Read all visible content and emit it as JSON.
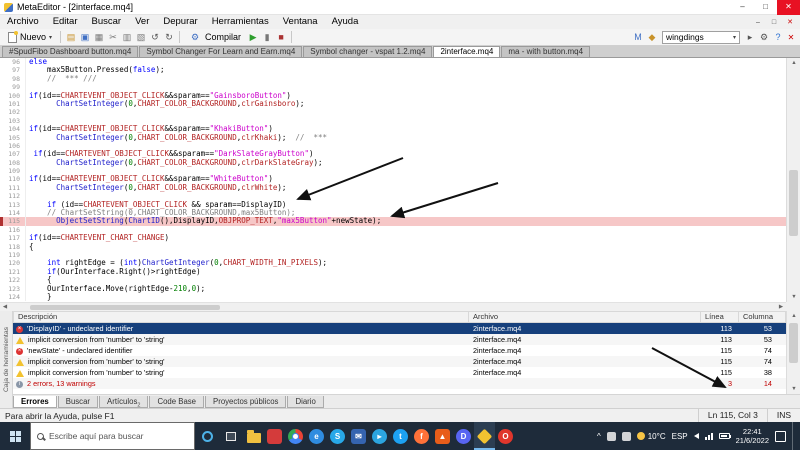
{
  "window": {
    "title": "MetaEditor - [2interface.mq4]"
  },
  "glyphs": {
    "min": "–",
    "max": "□",
    "close": "✕",
    "caret_down": "▾",
    "up": "▲",
    "down": "▼",
    "left": "◀",
    "right": "▶",
    "chevron_up": "^",
    "x": "×",
    "info": "i",
    "gear": "⚙"
  },
  "colors": {
    "highlight_line_bg": "#f6c7c7",
    "selection_bg": "#16407c",
    "error_red": "#c00000",
    "taskbar_bg": "#1e2b3a"
  },
  "menu": {
    "items": [
      "Archivo",
      "Editar",
      "Buscar",
      "Ver",
      "Depurar",
      "Herramientas",
      "Ventana",
      "Ayuda"
    ]
  },
  "toolbar": {
    "new_label": "Nuevo",
    "compile_label": "Compilar",
    "search_value": "wingdings",
    "groups": {
      "g1": [
        {
          "name": "open-file-icon",
          "glyph": "▤",
          "color": "#c8922a"
        },
        {
          "name": "save-icon",
          "glyph": "▣",
          "color": "#3f6fc4"
        },
        {
          "name": "print-icon",
          "glyph": "▦",
          "color": "#777777"
        },
        {
          "name": "cut-icon",
          "glyph": "✂",
          "color": "#777777"
        },
        {
          "name": "copy-icon",
          "glyph": "▥",
          "color": "#777777"
        },
        {
          "name": "paste-icon",
          "glyph": "▧",
          "color": "#777777"
        },
        {
          "name": "undo-icon",
          "glyph": "↺",
          "color": "#555555"
        },
        {
          "name": "redo-icon",
          "glyph": "↻",
          "color": "#555555"
        }
      ],
      "g2": [
        {
          "name": "start-debug-icon",
          "glyph": "▶",
          "color": "#2d9e2d"
        },
        {
          "name": "pause-icon",
          "glyph": "▮",
          "color": "#777777"
        },
        {
          "name": "stop-icon",
          "glyph": "■",
          "color": "#aa3333"
        }
      ],
      "g3": [
        {
          "name": "mql5-community-icon",
          "glyph": "M",
          "color": "#3f6fc4"
        },
        {
          "name": "terminal-icon",
          "glyph": "◆",
          "color": "#c8922a"
        }
      ],
      "g4": [
        {
          "name": "search-next-icon",
          "glyph": "▸",
          "color": "#555555"
        },
        {
          "name": "settings-icon",
          "glyph": "⚙",
          "color": "#555555"
        },
        {
          "name": "help-icon",
          "glyph": "?",
          "color": "#2a6fd0"
        }
      ]
    }
  },
  "file_tabs": [
    {
      "label": "#SpudFibo Dashboard button.mq4",
      "active": false
    },
    {
      "label": "Symbol Changer For Learn and Earn.mq4",
      "active": false
    },
    {
      "label": "Symbol changer - vspat 1.2.mq4",
      "active": false
    },
    {
      "label": "2interface.mq4",
      "active": true
    },
    {
      "label": "ma - with button.mq4",
      "active": false
    }
  ],
  "editor": {
    "highlight_line": 115,
    "lines": [
      {
        "n": 96,
        "seg": [
          [
            "k",
            "else"
          ]
        ]
      },
      {
        "n": 97,
        "seg": [
          [
            "p",
            "    max5Button.Pressed("
          ],
          [
            "k",
            "false"
          ],
          [
            "p",
            ");"
          ]
        ]
      },
      {
        "n": 98,
        "seg": [
          [
            "m",
            "    //  *** ///"
          ]
        ]
      },
      {
        "n": 99,
        "seg": []
      },
      {
        "n": 100,
        "seg": [
          [
            "k",
            "if"
          ],
          [
            "p",
            "(id=="
          ],
          [
            "c",
            "CHARTEVENT_OBJECT_CLICK"
          ],
          [
            "p",
            "&&sparam=="
          ],
          [
            "s",
            "\"GainsboroButton\""
          ],
          [
            "p",
            ")"
          ]
        ]
      },
      {
        "n": 101,
        "seg": [
          [
            "p",
            "      "
          ],
          [
            "f",
            "ChartSetInteger"
          ],
          [
            "p",
            "("
          ],
          [
            "n",
            "0"
          ],
          [
            "p",
            ","
          ],
          [
            "c",
            "CHART_COLOR_BACKGROUND"
          ],
          [
            "p",
            ","
          ],
          [
            "c",
            "clrGainsboro"
          ],
          [
            "p",
            ");"
          ]
        ]
      },
      {
        "n": 102,
        "seg": []
      },
      {
        "n": 103,
        "seg": []
      },
      {
        "n": 104,
        "seg": [
          [
            "k",
            "if"
          ],
          [
            "p",
            "(id=="
          ],
          [
            "c",
            "CHARTEVENT_OBJECT_CLICK"
          ],
          [
            "p",
            "&&sparam=="
          ],
          [
            "s",
            "\"KhakiButton\""
          ],
          [
            "p",
            ")"
          ]
        ]
      },
      {
        "n": 105,
        "seg": [
          [
            "p",
            "      "
          ],
          [
            "f",
            "ChartSetInteger"
          ],
          [
            "p",
            "("
          ],
          [
            "n",
            "0"
          ],
          [
            "p",
            ","
          ],
          [
            "c",
            "CHART_COLOR_BACKGROUND"
          ],
          [
            "p",
            ","
          ],
          [
            "c",
            "clrKhaki"
          ],
          [
            "p",
            ");  "
          ],
          [
            "m",
            "//  ***"
          ]
        ]
      },
      {
        "n": 106,
        "seg": []
      },
      {
        "n": 107,
        "seg": [
          [
            "p",
            " "
          ],
          [
            "k",
            "if"
          ],
          [
            "p",
            "(id=="
          ],
          [
            "c",
            "CHARTEVENT_OBJECT_CLICK"
          ],
          [
            "p",
            "&&sparam=="
          ],
          [
            "s",
            "\"DarkSlateGrayButton\""
          ],
          [
            "p",
            ")"
          ]
        ]
      },
      {
        "n": 108,
        "seg": [
          [
            "p",
            "      "
          ],
          [
            "f",
            "ChartSetInteger"
          ],
          [
            "p",
            "("
          ],
          [
            "n",
            "0"
          ],
          [
            "p",
            ","
          ],
          [
            "c",
            "CHART_COLOR_BACKGROUND"
          ],
          [
            "p",
            ","
          ],
          [
            "c",
            "clrDarkSlateGray"
          ],
          [
            "p",
            ");"
          ]
        ]
      },
      {
        "n": 109,
        "seg": []
      },
      {
        "n": 110,
        "seg": [
          [
            "k",
            "if"
          ],
          [
            "p",
            "(id=="
          ],
          [
            "c",
            "CHARTEVENT_OBJECT_CLICK"
          ],
          [
            "p",
            "&&sparam=="
          ],
          [
            "s",
            "\"WhiteButton\""
          ],
          [
            "p",
            ")"
          ]
        ]
      },
      {
        "n": 111,
        "seg": [
          [
            "p",
            "      "
          ],
          [
            "f",
            "ChartSetInteger"
          ],
          [
            "p",
            "("
          ],
          [
            "n",
            "0"
          ],
          [
            "p",
            ","
          ],
          [
            "c",
            "CHART_COLOR_BACKGROUND"
          ],
          [
            "p",
            ","
          ],
          [
            "c",
            "clrWhite"
          ],
          [
            "p",
            ");"
          ]
        ]
      },
      {
        "n": 112,
        "seg": []
      },
      {
        "n": 113,
        "seg": [
          [
            "p",
            "    "
          ],
          [
            "k",
            "if"
          ],
          [
            "p",
            " (id=="
          ],
          [
            "c",
            "CHARTEVENT_OBJECT_CLICK"
          ],
          [
            "p",
            " && sparam==DisplayID)"
          ]
        ]
      },
      {
        "n": 114,
        "seg": [
          [
            "m",
            "    // ChartSetString(0,CHART_COLOR_BACKGROUND,max5Button);"
          ]
        ]
      },
      {
        "n": 115,
        "seg": [
          [
            "p",
            "      "
          ],
          [
            "f",
            "ObjectSetString"
          ],
          [
            "p",
            "("
          ],
          [
            "f",
            "ChartID"
          ],
          [
            "p",
            "(),DisplayID,"
          ],
          [
            "c",
            "OBJPROP_TEXT"
          ],
          [
            "p",
            ","
          ],
          [
            "s",
            "\"max5Button\""
          ],
          [
            "p",
            "+newState);"
          ]
        ]
      },
      {
        "n": 116,
        "seg": []
      },
      {
        "n": 117,
        "seg": [
          [
            "k",
            "if"
          ],
          [
            "p",
            "(id=="
          ],
          [
            "c",
            "CHARTEVENT_CHART_CHANGE"
          ],
          [
            "p",
            ")"
          ]
        ]
      },
      {
        "n": 118,
        "seg": [
          [
            "p",
            "{"
          ]
        ]
      },
      {
        "n": 119,
        "seg": []
      },
      {
        "n": 120,
        "seg": [
          [
            "p",
            "    "
          ],
          [
            "k",
            "int"
          ],
          [
            "p",
            " rightEdge = ("
          ],
          [
            "k",
            "int"
          ],
          [
            "p",
            ")"
          ],
          [
            "f",
            "ChartGetInteger"
          ],
          [
            "p",
            "("
          ],
          [
            "n",
            "0"
          ],
          [
            "p",
            ","
          ],
          [
            "c",
            "CHART_WIDTH_IN_PIXELS"
          ],
          [
            "p",
            ");"
          ]
        ]
      },
      {
        "n": 121,
        "seg": [
          [
            "p",
            "    "
          ],
          [
            "k",
            "if"
          ],
          [
            "p",
            "(OurInterface.Right()>rightEdge)"
          ]
        ]
      },
      {
        "n": 122,
        "seg": [
          [
            "p",
            "    {"
          ]
        ]
      },
      {
        "n": 123,
        "seg": [
          [
            "p",
            "    OurInterface.Move(rightEdge-"
          ],
          [
            "n",
            "210"
          ],
          [
            "p",
            ","
          ],
          [
            "n",
            "0"
          ],
          [
            "p",
            ");"
          ]
        ]
      },
      {
        "n": 124,
        "seg": [
          [
            "p",
            "    }"
          ]
        ]
      }
    ]
  },
  "errors_panel": {
    "columns": [
      "Descripción",
      "Archivo",
      "Línea",
      "Columna"
    ],
    "rows": [
      {
        "icon": "error",
        "desc": "'DisplayID' - undeclared identifier",
        "file": "2interface.mq4",
        "line": "113",
        "col": "53",
        "selected": true
      },
      {
        "icon": "warning",
        "desc": "implicit conversion from 'number' to 'string'",
        "file": "2interface.mq4",
        "line": "113",
        "col": "53"
      },
      {
        "icon": "error",
        "desc": "'newState' - undeclared identifier",
        "file": "2interface.mq4",
        "line": "115",
        "col": "74"
      },
      {
        "icon": "warning",
        "desc": "implicit conversion from 'number' to 'string'",
        "file": "2interface.mq4",
        "line": "115",
        "col": "74"
      },
      {
        "icon": "warning",
        "desc": "implicit conversion from 'number' to 'string'",
        "file": "2interface.mq4",
        "line": "115",
        "col": "38"
      },
      {
        "icon": "summary",
        "desc": "2 errors, 13 warnings",
        "file": "",
        "line": "3",
        "col": "14",
        "summary": true
      }
    ]
  },
  "toolbox_label": "Caja de herramientas",
  "bottom_tabs": [
    {
      "label": "Errores",
      "active": true
    },
    {
      "label": "Buscar",
      "active": false
    },
    {
      "label": "Artículos",
      "badge": "2",
      "active": false
    },
    {
      "label": "Code Base",
      "active": false
    },
    {
      "label": "Proyectos públicos",
      "active": false
    },
    {
      "label": "Diario",
      "active": false
    }
  ],
  "status_bar": {
    "help": "Para abrir la Ayuda, pulse F1",
    "position": "Ln 115, Col 3",
    "mode": "INS"
  },
  "taskbar": {
    "search_placeholder": "Escribe aquí para buscar",
    "icons": [
      {
        "name": "taskbar-file-explorer-icon",
        "color": "#f0c040",
        "shape": "folder",
        "letter": ""
      },
      {
        "name": "taskbar-app-red-icon",
        "color": "#d43b3b",
        "shape": "square",
        "letter": ""
      },
      {
        "name": "taskbar-chrome-icon",
        "color": "",
        "shape": "chrome",
        "letter": ""
      },
      {
        "name": "taskbar-edge-icon",
        "color": "#2f8ce0",
        "shape": "circle",
        "letter": "e"
      },
      {
        "name": "taskbar-skype-icon",
        "color": "#28a8e8",
        "shape": "circle",
        "letter": "S"
      },
      {
        "name": "taskbar-mail-icon",
        "color": "#3564b0",
        "shape": "square",
        "letter": "✉"
      },
      {
        "name": "taskbar-telegram-icon",
        "color": "#2ca5e0",
        "shape": "circle",
        "letter": "▸"
      },
      {
        "name": "taskbar-twitter-icon",
        "color": "#1da1f2",
        "shape": "circle",
        "letter": "t"
      },
      {
        "name": "taskbar-firefox-icon",
        "color": "#ff7139",
        "shape": "circle",
        "letter": "f"
      },
      {
        "name": "taskbar-vlc-icon",
        "color": "#e85d1a",
        "shape": "square",
        "letter": "▲"
      },
      {
        "name": "taskbar-discord-icon",
        "color": "#5865f2",
        "shape": "circle",
        "letter": "D"
      },
      {
        "name": "taskbar-metaeditor-icon",
        "color": "#f2c230",
        "shape": "diamond",
        "letter": "",
        "active": true
      },
      {
        "name": "taskbar-opera-icon",
        "color": "#e0362c",
        "shape": "circle",
        "letter": "O"
      }
    ],
    "tray": {
      "temp": "10°C",
      "lang": "ESP",
      "time": "22:41",
      "date": "21/6/2022"
    }
  }
}
